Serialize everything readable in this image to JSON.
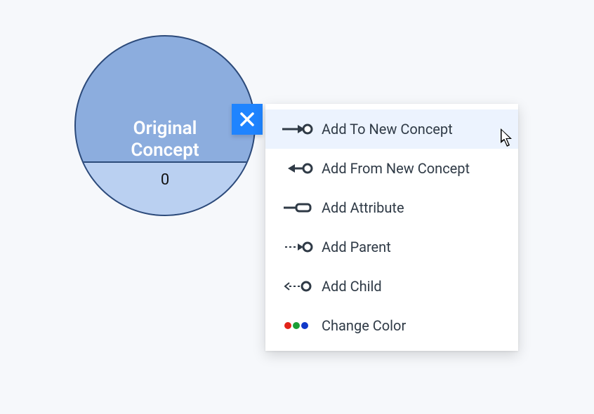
{
  "concept": {
    "title_line1": "Original",
    "title_line2": "Concept",
    "count": "0"
  },
  "menu": {
    "highlighted_index": 0,
    "items": [
      {
        "icon": "arrow-to-node-icon",
        "label": "Add To New Concept"
      },
      {
        "icon": "arrow-from-node-icon",
        "label": "Add From New Concept"
      },
      {
        "icon": "attribute-icon",
        "label": "Add Attribute"
      },
      {
        "icon": "parent-icon",
        "label": "Add Parent"
      },
      {
        "icon": "child-icon",
        "label": "Add Child"
      },
      {
        "icon": "color-dots-icon",
        "label": "Change Color"
      }
    ]
  },
  "colors": {
    "node_fill": "#8cadde",
    "node_border": "#2c4a7a",
    "node_bottom_fill": "#bad0f1",
    "menu_highlight": "#ecf3fe",
    "close_button": "#1f84ff"
  }
}
